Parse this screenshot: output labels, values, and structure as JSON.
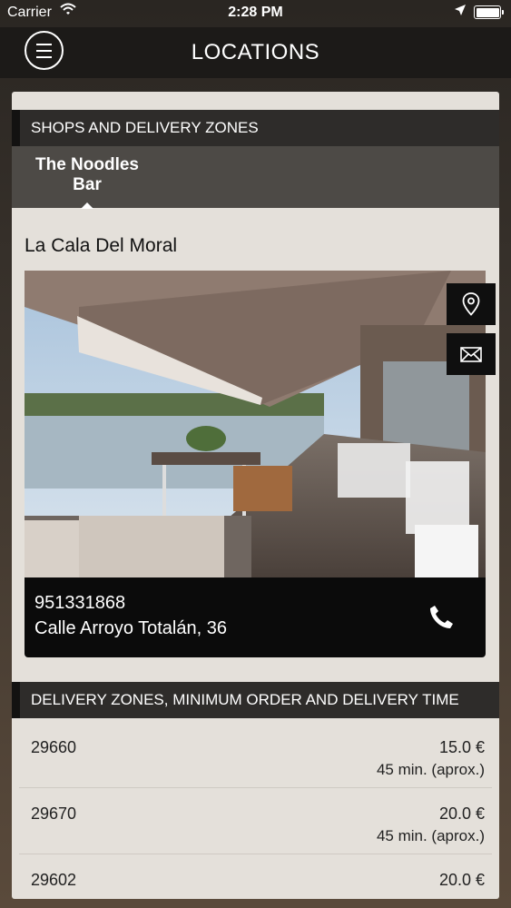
{
  "status_bar": {
    "carrier": "Carrier",
    "time": "2:28 PM"
  },
  "header": {
    "title": "LOCATIONS"
  },
  "shops_section": {
    "title": "SHOPS AND DELIVERY ZONES"
  },
  "tabs": [
    {
      "label": "The Noodles Bar"
    }
  ],
  "location": {
    "name": "La Cala Del Moral",
    "phone": "951331868",
    "address": "Calle Arroyo Totalán, 36"
  },
  "delivery_section": {
    "title": "DELIVERY ZONES, MINIMUM ORDER AND DELIVERY TIME"
  },
  "delivery_zones": [
    {
      "zip": "29660",
      "min_order": "15.0 €",
      "time": "45 min. (aprox.)"
    },
    {
      "zip": "29670",
      "min_order": "20.0 €",
      "time": "45 min. (aprox.)"
    },
    {
      "zip": "29602",
      "min_order": "20.0 €",
      "time": ""
    }
  ],
  "icons": {
    "menu": "hamburger-icon",
    "map": "map-pin-icon",
    "mail": "envelope-icon",
    "call": "phone-icon"
  }
}
